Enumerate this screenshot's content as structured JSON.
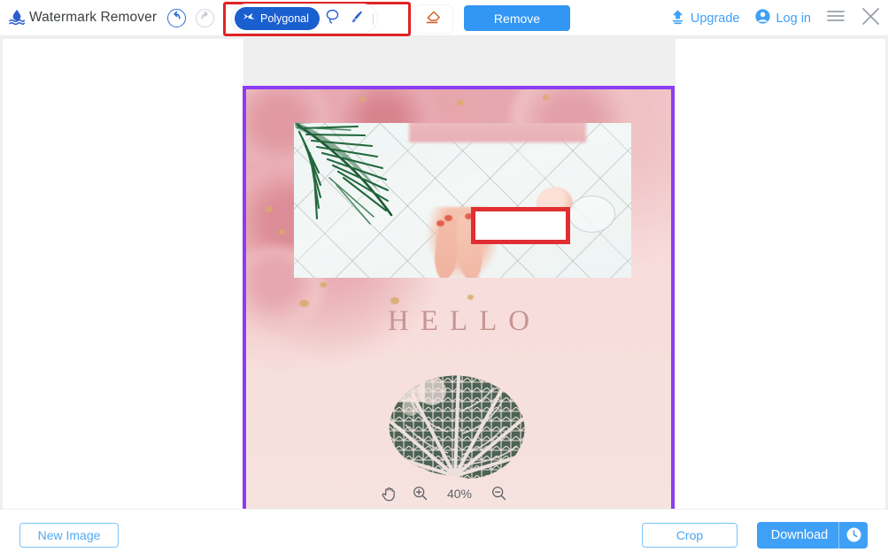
{
  "app": {
    "title": "Watermark Remover",
    "logo_icon": "watermark-droplet-icon"
  },
  "toolbar": {
    "undo_icon": "undo-arrow-icon",
    "redo_icon": "redo-arrow-icon",
    "tools": [
      {
        "id": "polygonal",
        "label": "Polygonal",
        "icon": "polygon-lasso-icon",
        "active": true
      },
      {
        "id": "lasso",
        "label": "",
        "icon": "lasso-icon",
        "active": false
      },
      {
        "id": "brush",
        "label": "",
        "icon": "brush-icon",
        "active": false
      }
    ],
    "eraser_icon": "eraser-icon",
    "remove_label": "Remove",
    "upgrade_label": "Upgrade",
    "upgrade_icon": "upload-upgrade-icon",
    "login_label": "Log in",
    "login_icon": "user-circle-icon",
    "menu_icon": "hamburger-menu-icon",
    "close_icon": "close-x-icon"
  },
  "canvas": {
    "hello_text": "HELLO",
    "selection_border_color": "#8b3df5",
    "marked_region_color": "#e12e33",
    "zoom": {
      "hand_icon": "hand-pan-icon",
      "zoom_in_icon": "zoom-in-icon",
      "level": "40%",
      "zoom_out_icon": "zoom-out-icon"
    }
  },
  "footer": {
    "new_image_label": "New Image",
    "crop_label": "Crop",
    "download_label": "Download",
    "download_history_icon": "clock-history-icon"
  },
  "colors": {
    "primary_blue": "#3fa0f7",
    "tool_active_blue": "#1a5fd0",
    "highlight_red": "#e02326",
    "selection_purple": "#8b3df5"
  }
}
